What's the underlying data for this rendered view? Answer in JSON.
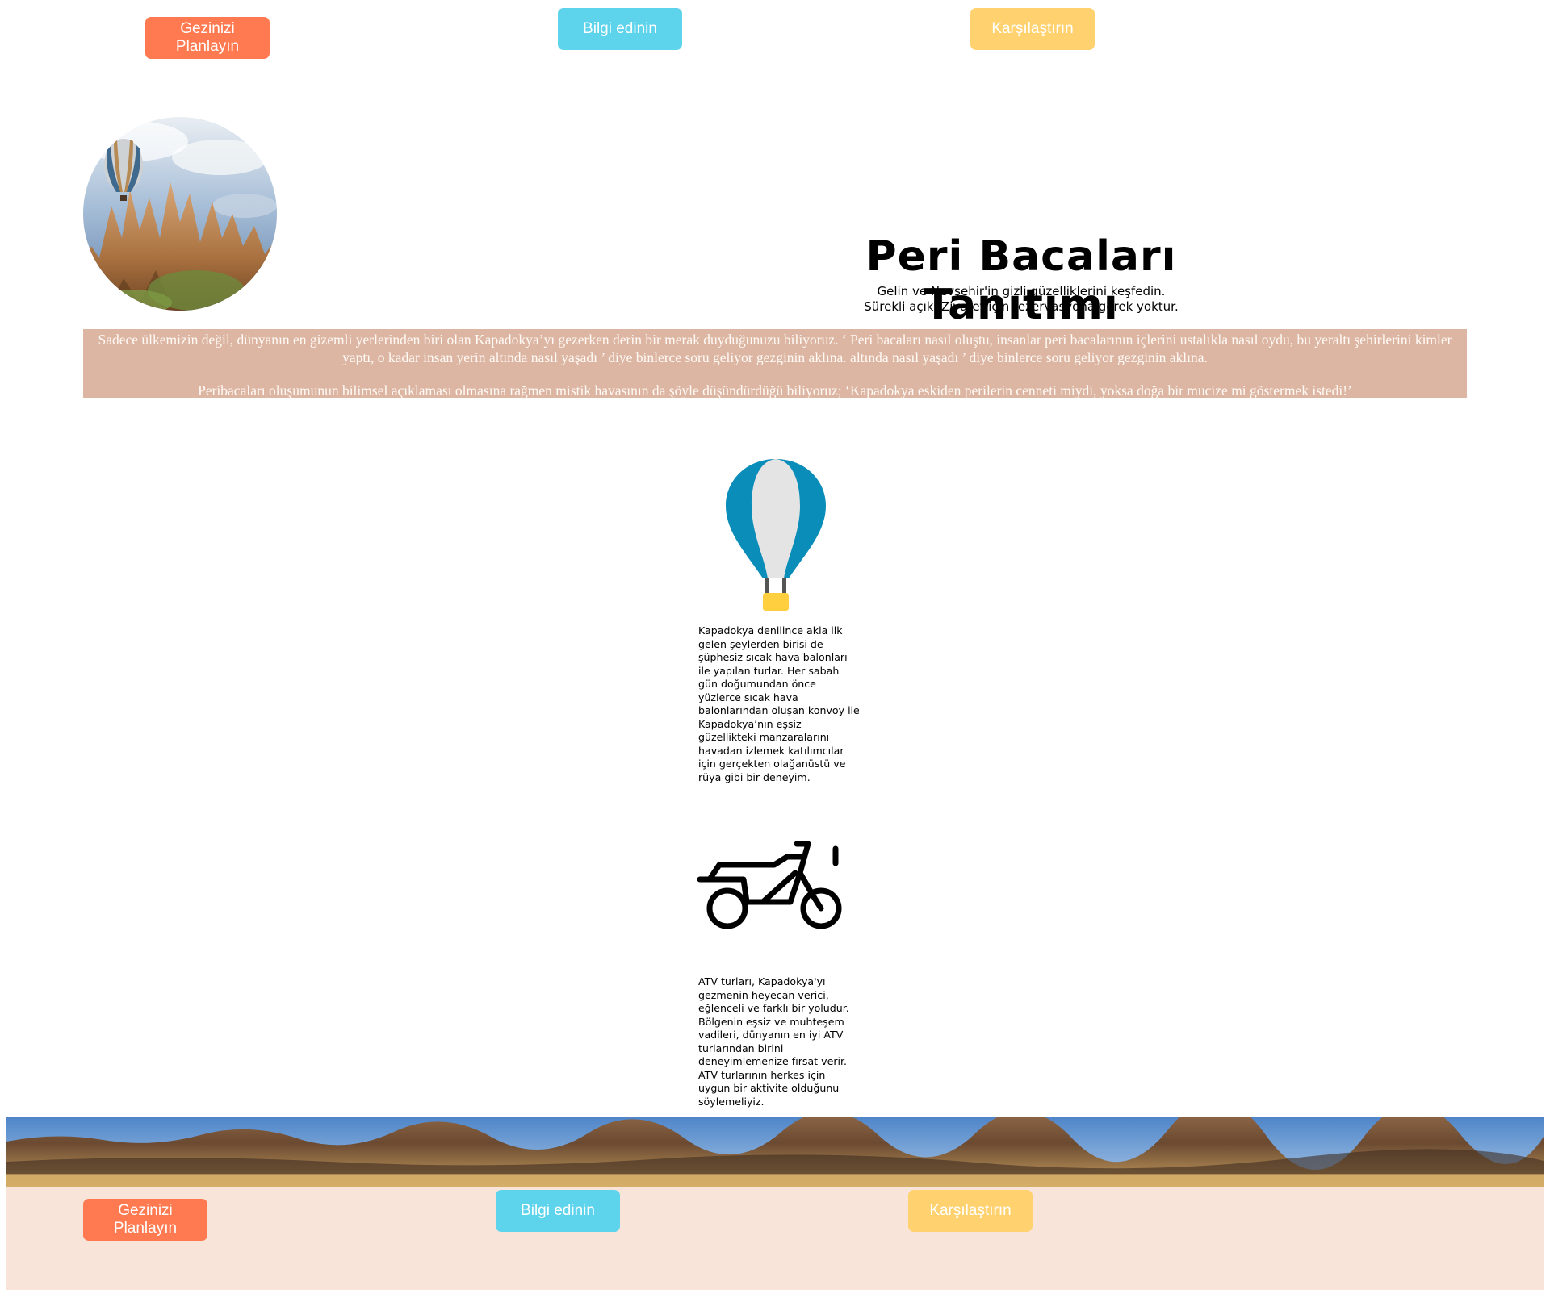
{
  "colors": {
    "plan_button": "#ff7a50",
    "info_button": "#5dd3ec",
    "compare_button": "#ffd26f",
    "intro_background": "#dcb6a3",
    "footer_background": "#f8e4d8"
  },
  "top_nav": {
    "plan_label": "Gezinizi Planlayın",
    "info_label": "Bilgi edinin",
    "compare_label": "Karşılaştırın"
  },
  "hero": {
    "title": "Peri Bacaları Tanıtımı",
    "subtitle_line1": "Gelin ve Nevşehir'in gizli güzelliklerini keşfedin.",
    "subtitle_line2": "Sürekli açık. Ziyaret için rezervasyona gerek yoktur."
  },
  "intro": {
    "paragraph1": "Sadece ülkemizin değil, dünyanın en gizemli yerlerinden biri olan Kapadokya’yı gezerken derin bir merak duyduğunuzu biliyoruz. ‘ Peri bacaları nasıl oluştu, insanlar peri bacalarının içlerini ustalıkla nasıl oydu, bu yeraltı şehirlerini kimler yaptı, o kadar insan yerin altında nasıl yaşadı ’ diye binlerce soru geliyor gezginin aklına. altında nasıl yaşadı ’ diye binlerce soru geliyor gezginin aklına.",
    "paragraph2": "Peribacaları oluşumunun bilimsel açıklaması olmasına rağmen mistik havasının da şöyle düşündürdüğü biliyoruz; ‘Kapadokya eskiden perilerin cenneti miydi, yoksa doğa bir mucize mi göstermek istedi!’"
  },
  "features": {
    "balloon": {
      "icon": "hot-air-balloon-icon",
      "text": "Kapadokya denilince akla ilk gelen şeylerden birisi de şüphesiz sıcak hava balonları ile yapılan turlar. Her sabah gün doğumundan önce yüzlerce sıcak hava balonlarından oluşan konvoy ile Kapadokya’nın eşsiz güzellikteki manzaralarını havadan izlemek katılımcılar için gerçekten olağanüstü ve rüya gibi bir deneyim."
    },
    "atv": {
      "icon": "atv-icon",
      "text": "ATV turları, Kapadokya'yı gezmenin heyecan verici, eğlenceli ve farklı bir yoludur. Bölgenin eşsiz ve muhteşem vadileri, dünyanın en iyi ATV turlarından birini deneyimlemenize fırsat verir. ATV turlarının herkes için uygun bir aktivite olduğunu söylemeliyiz."
    }
  },
  "footer_nav": {
    "plan_label": "Gezinizi Planlayın",
    "info_label": "Bilgi edinin",
    "compare_label": "Karşılaştırın"
  }
}
